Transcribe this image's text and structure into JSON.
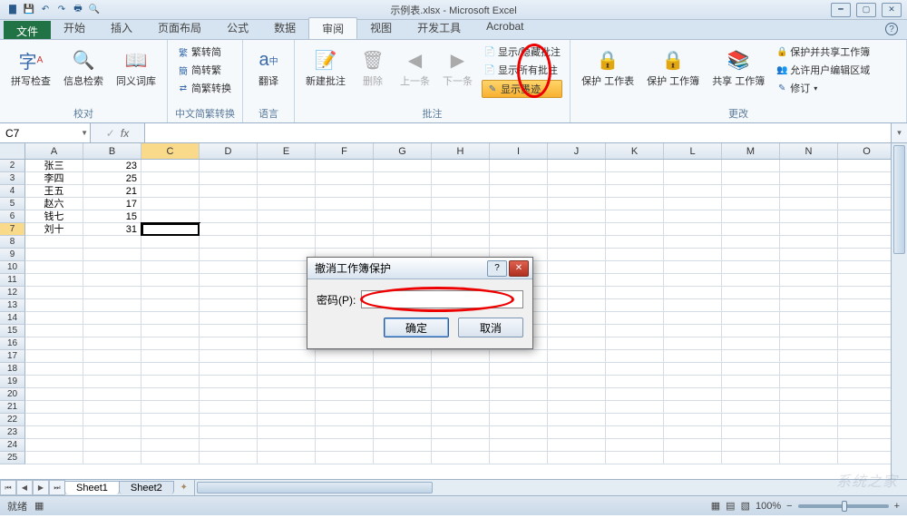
{
  "title": "示例表.xlsx - Microsoft Excel",
  "qat": [
    "save",
    "undo",
    "redo",
    "print",
    "preview",
    "new"
  ],
  "tabs": {
    "file": "文件",
    "items": [
      "开始",
      "插入",
      "页面布局",
      "公式",
      "数据",
      "审阅",
      "视图",
      "开发工具",
      "Acrobat"
    ],
    "active": "审阅"
  },
  "ribbon": {
    "proofing": {
      "spell": "拼写检查",
      "research": "信息检索",
      "thesaurus": "同义词库",
      "label": "校对"
    },
    "cc": {
      "s2t": "繁转简",
      "t2s": "简转繁",
      "conv": "简繁转换",
      "label": "中文简繁转换"
    },
    "lang": {
      "translate": "翻译",
      "label": "语言"
    },
    "comments": {
      "new": "新建批注",
      "del": "删除",
      "prev": "上一条",
      "next": "下一条",
      "showhide": "显示/隐藏批注",
      "showall": "显示所有批注",
      "ink": "显示墨迹",
      "label": "批注"
    },
    "changes": {
      "protect_sheet": "保护\n工作表",
      "protect_wb": "保护\n工作簿",
      "share": "共享\n工作簿",
      "pns": "保护并共享工作簿",
      "allow": "允许用户编辑区域",
      "track": "修订",
      "label": "更改"
    }
  },
  "namebox": "C7",
  "fx_label": "fx",
  "columns": [
    "A",
    "B",
    "C",
    "D",
    "E",
    "F",
    "G",
    "H",
    "I",
    "J",
    "K",
    "L",
    "M",
    "N",
    "O"
  ],
  "selected_col": "C",
  "selected_row": 7,
  "rows": [
    {
      "n": 2,
      "A": "张三",
      "B": "23"
    },
    {
      "n": 3,
      "A": "李四",
      "B": "25"
    },
    {
      "n": 4,
      "A": "王五",
      "B": "21"
    },
    {
      "n": 5,
      "A": "赵六",
      "B": "17"
    },
    {
      "n": 6,
      "A": "钱七",
      "B": "15"
    },
    {
      "n": 7,
      "A": "刘十",
      "B": "31"
    }
  ],
  "max_row": 25,
  "sheets": {
    "nav": [
      "⏮",
      "◀",
      "▶",
      "⏭"
    ],
    "tabs": [
      "Sheet1",
      "Sheet2"
    ],
    "active": "Sheet1"
  },
  "status": {
    "ready": "就绪",
    "calc_icon": "▦",
    "zoom": "100%"
  },
  "dialog": {
    "title": "撤消工作簿保护",
    "pwd_label": "密码(P):",
    "pwd_value": "",
    "ok": "确定",
    "cancel": "取消"
  },
  "watermark": "系统之家"
}
